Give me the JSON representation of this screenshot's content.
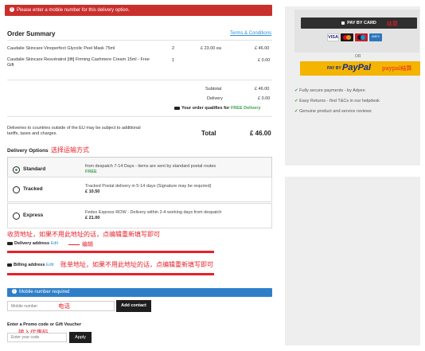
{
  "error_banner": "Please enter a mobile number for this delivery option.",
  "order_summary": {
    "title": "Order Summary",
    "terms_link": "Terms & Conditions",
    "items": [
      {
        "name": "Caudalie Skincare Vinoperfect Glycolic Peel Mask 75ml",
        "qty": "2",
        "unit": "£ 23.00 ea",
        "total": "£ 46.00"
      },
      {
        "name": "Caudalie Skincare Resvératrol [lift] Firming Cashmere Cream 15ml - Free Gift",
        "qty": "1",
        "unit": "",
        "total": "£ 0.00"
      }
    ],
    "subtotal_label": "Subtotal",
    "subtotal_value": "£ 46.00",
    "delivery_label": "Delivery",
    "delivery_value": "£ 0.00",
    "free_delivery_prefix": "Your order qualifies for",
    "free_delivery_highlight": "FREE Delivery",
    "eu_note": "Deliveries to countries outside of the EU may be subject to additional tariffs, taxes and charges.",
    "total_label": "Total",
    "total_value": "£ 46.00"
  },
  "delivery_options": {
    "title": "Delivery Options",
    "annotation": "选择运输方式",
    "options": [
      {
        "name": "Standard",
        "desc": "from despatch 7-14 Days - items are sent by standard postal routes",
        "price": "FREE",
        "selected": true
      },
      {
        "name": "Tracked",
        "desc": "Tracked Postal delivery in 5-14 days (Signature may be required)",
        "price": "£ 10.50",
        "selected": false
      },
      {
        "name": "Express",
        "desc": "Fedex Express ROW - Delivery within 2-4 working days from despatch",
        "price": "£ 21.00",
        "selected": false
      }
    ]
  },
  "delivery_address": {
    "annotation_top": "收货地址，如果不用此地址的话，点编辑重新填写即可",
    "label": "Delivery address",
    "edit": "Edit",
    "annotation_edit": "编辑"
  },
  "billing_address": {
    "label": "Billing address",
    "edit": "Edit",
    "annotation": "账单地址，如果不用此地址的话，点编辑重新填写即可"
  },
  "mobile": {
    "banner": "Mobile number required",
    "placeholder": "Mobile number",
    "annotation": "电话",
    "add_button": "Add contact"
  },
  "promo": {
    "title": "Enter a Promo code or Gift Voucher",
    "annotation": "输入优惠码",
    "placeholder": "Enter your code",
    "apply_button": "Apply"
  },
  "payment": {
    "pay_by_card": "PAY BY CARD",
    "card_annotation": "结算",
    "or": "OR",
    "paypal_prefix": "PAY BY",
    "paypal_brand": "PayPal",
    "paypal_annotation": "paypal结算",
    "features": [
      "Fully secure payments - by Adyen",
      "Easy Returns - find T&Cs in our helpdesk",
      "Genuine product and service reviews"
    ]
  },
  "colors": {
    "error": "#c9302c",
    "info": "#2e7fc9",
    "paypal_yellow": "#f4b400",
    "annotation_red": "#e8202a",
    "success_green": "#3fa34d"
  }
}
